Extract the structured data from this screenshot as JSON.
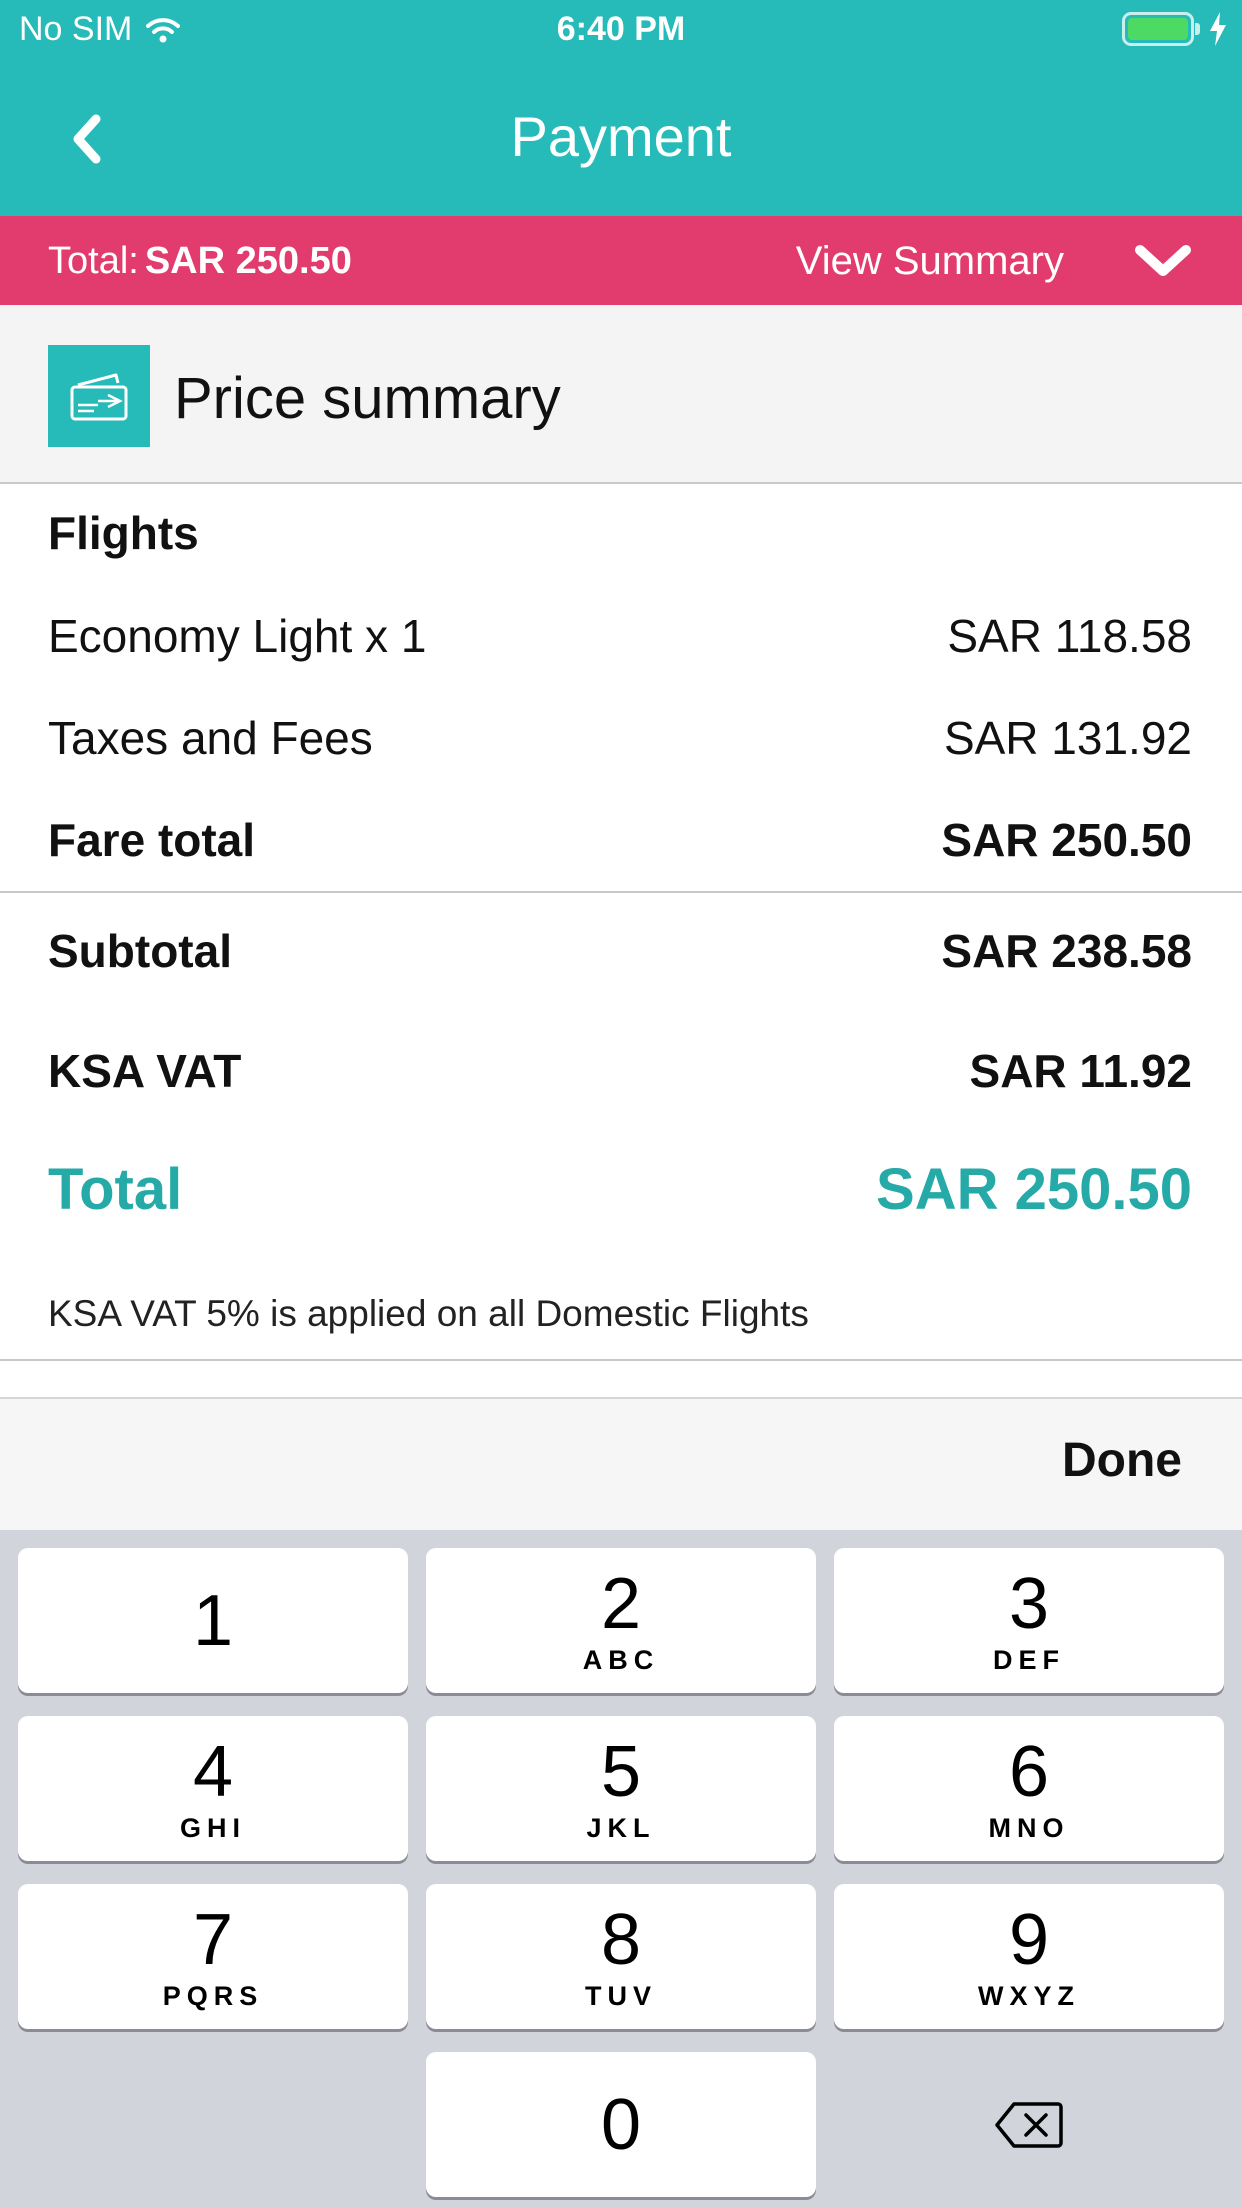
{
  "status_bar": {
    "carrier": "No SIM",
    "time": "6:40 PM"
  },
  "nav": {
    "title": "Payment"
  },
  "total_bar": {
    "label": "Total:",
    "amount": "SAR 250.50",
    "view_summary": "View Summary"
  },
  "price_summary": {
    "title": "Price summary",
    "section": "Flights",
    "items": [
      {
        "label": "Economy Light x 1",
        "value": "SAR 118.58"
      },
      {
        "label": "Taxes and Fees",
        "value": "SAR 131.92"
      }
    ],
    "fare_total": {
      "label": "Fare total",
      "value": "SAR 250.50"
    },
    "subtotal": {
      "label": "Subtotal",
      "value": "SAR 238.58"
    },
    "vat": {
      "label": "KSA VAT",
      "value": "SAR 11.92"
    },
    "total": {
      "label": "Total",
      "value": "SAR 250.50"
    },
    "note": "KSA VAT 5% is applied on all Domestic Flights"
  },
  "keyboard": {
    "done": "Done",
    "keys": [
      {
        "num": "1",
        "letters": ""
      },
      {
        "num": "2",
        "letters": "ABC"
      },
      {
        "num": "3",
        "letters": "DEF"
      },
      {
        "num": "4",
        "letters": "GHI"
      },
      {
        "num": "5",
        "letters": "JKL"
      },
      {
        "num": "6",
        "letters": "MNO"
      },
      {
        "num": "7",
        "letters": "PQRS"
      },
      {
        "num": "8",
        "letters": "TUV"
      },
      {
        "num": "9",
        "letters": "WXYZ"
      },
      {
        "num": "0",
        "letters": ""
      }
    ]
  },
  "colors": {
    "teal": "#26bbb9",
    "pink": "#e23c6e",
    "total_teal": "#26aaa8",
    "keyboard_bg": "#d1d4db"
  }
}
